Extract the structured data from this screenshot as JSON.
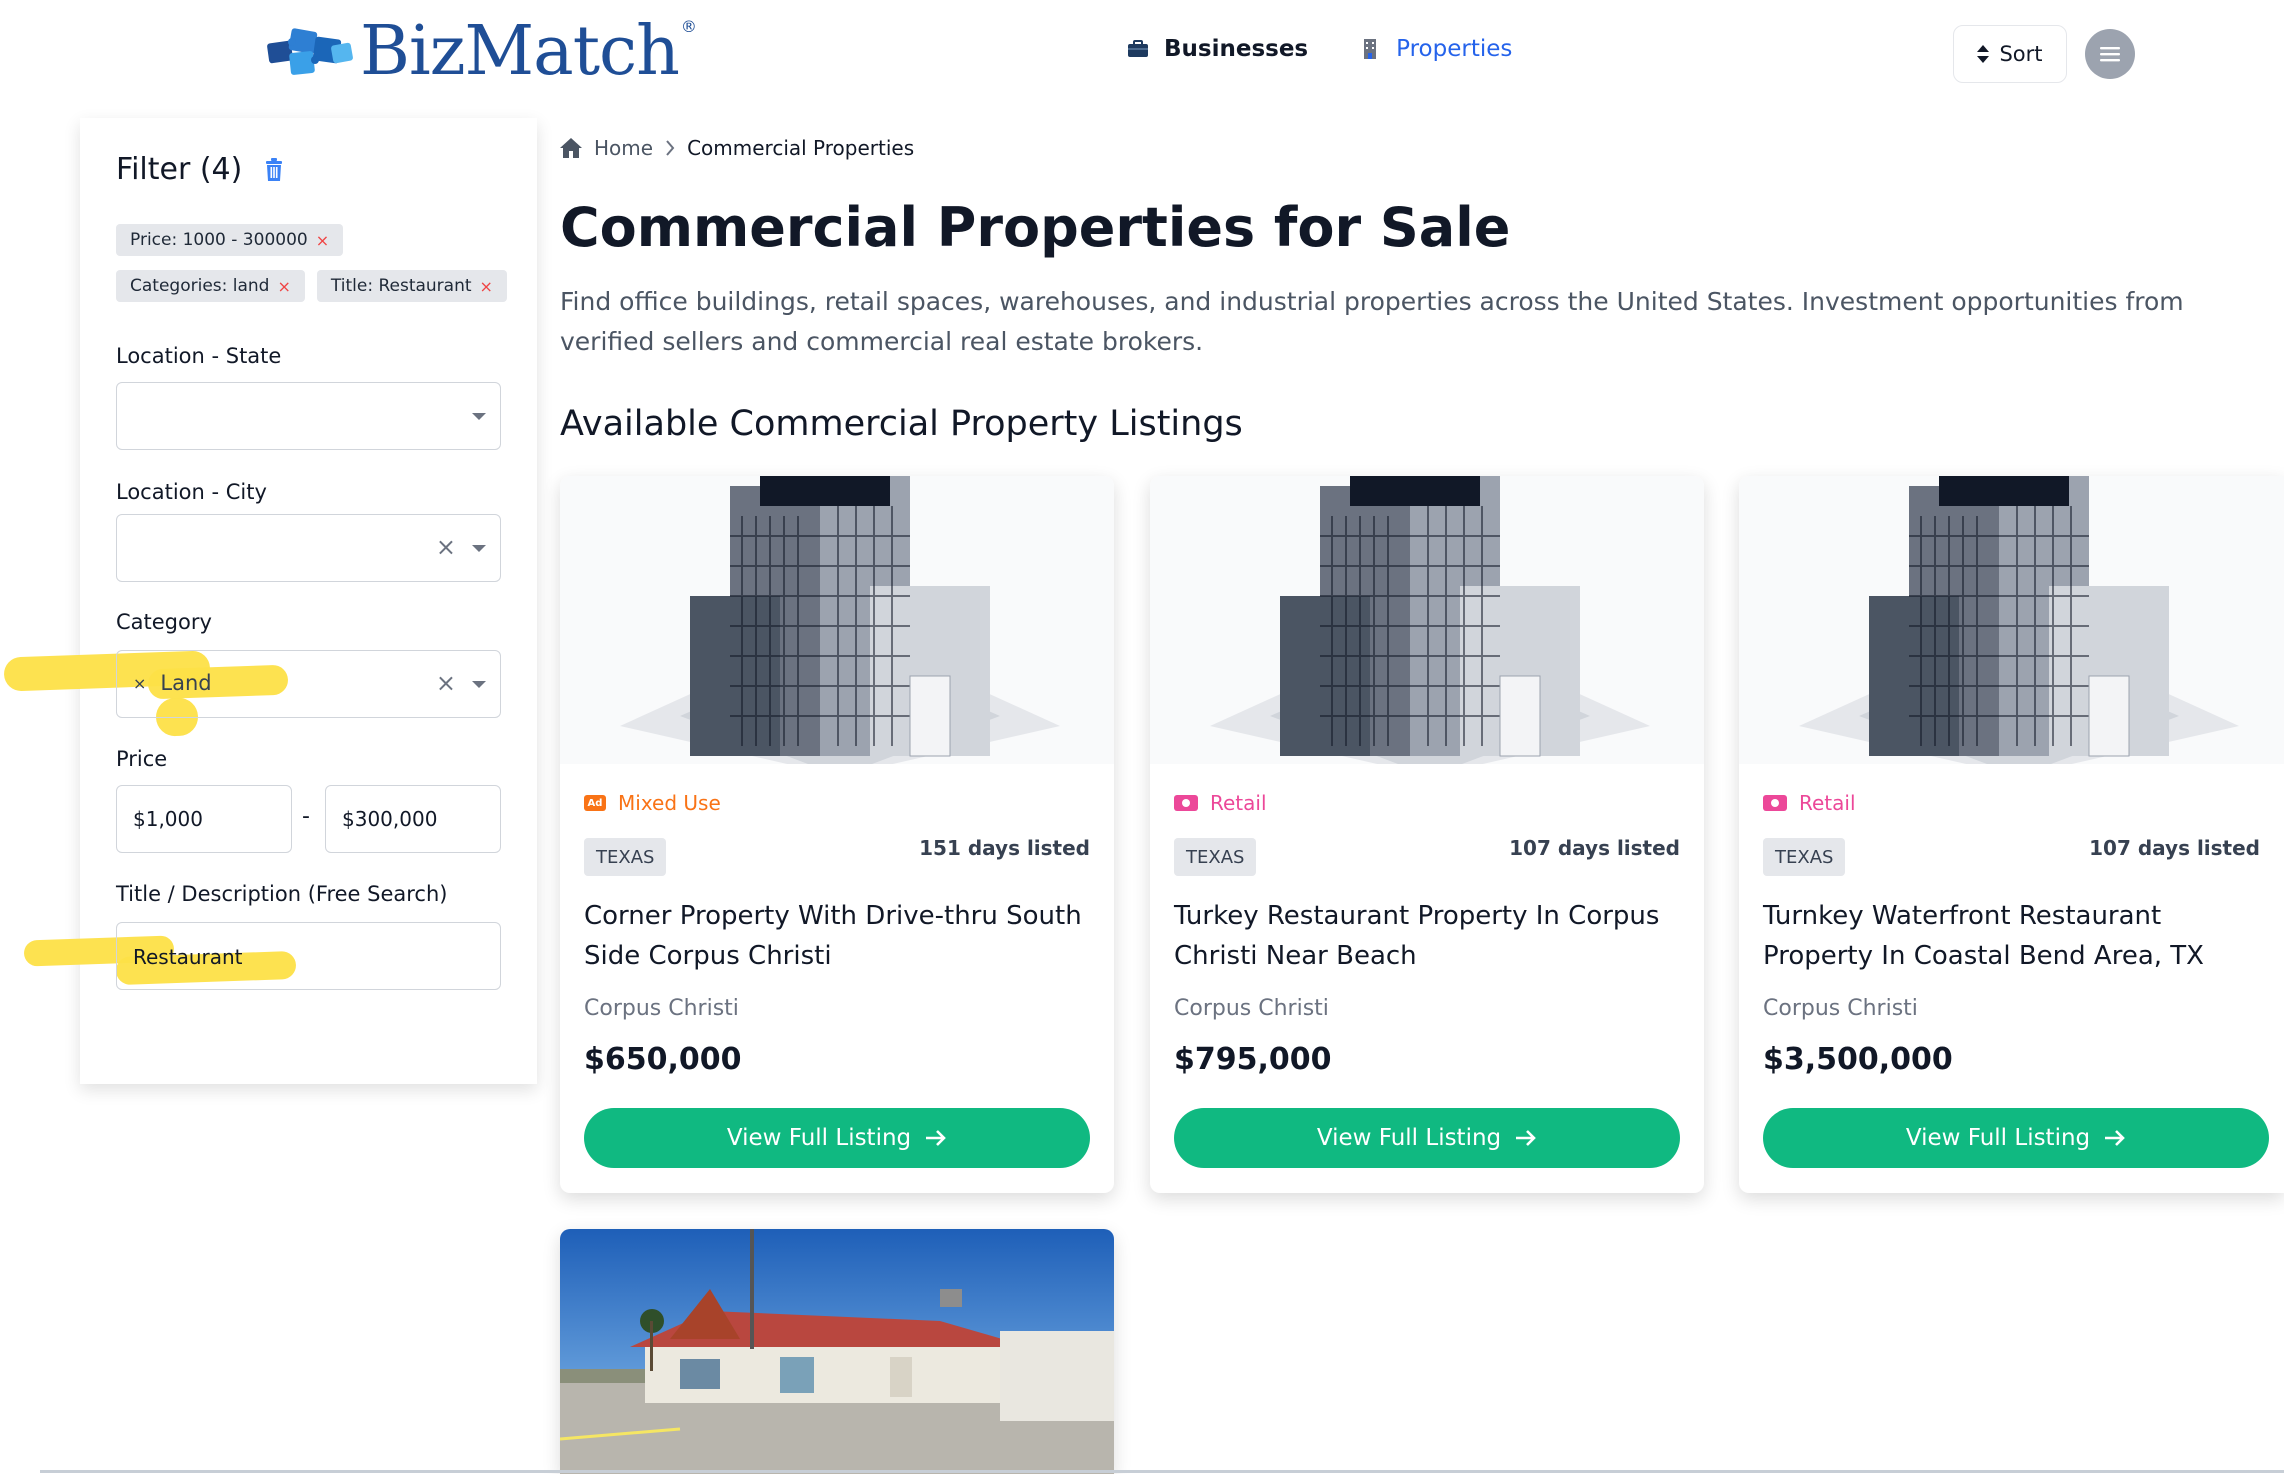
{
  "brand": {
    "name": "BizMatch",
    "reg": "®"
  },
  "nav": [
    {
      "label": "Businesses"
    },
    {
      "label": "Properties"
    }
  ],
  "sort": {
    "label": "Sort"
  },
  "filter": {
    "title": "Filter (4)",
    "chips": [
      "Price: 1000 - 300000",
      "Categories: land",
      "Title: Restaurant"
    ],
    "state_label": "Location - State",
    "city_label": "Location - City",
    "category_label": "Category",
    "category_value": "Land",
    "price_label": "Price",
    "price_min": "$1,000",
    "price_sep": "-",
    "price_max": "$300,000",
    "search_label": "Title / Description (Free Search)",
    "search_value": "Restaurant"
  },
  "breadcrumb": {
    "home": "Home",
    "current": "Commercial Properties"
  },
  "page": {
    "title": "Commercial Properties for Sale",
    "description": "Find office buildings, retail spaces, warehouses, and industrial properties across the United States. Investment opportunities from verified sellers and commercial real estate brokers.",
    "section": "Available Commercial Property Listings"
  },
  "listings": [
    {
      "category": "Mixed Use",
      "category_color": "#f97316",
      "icon_text": "Ad",
      "state": "TEXAS",
      "days": "151 days listed",
      "title": "Corner Property With Drive-thru South Side Corpus Christi",
      "city": "Corpus Christi",
      "price": "$650,000",
      "cta": "View Full Listing"
    },
    {
      "category": "Retail",
      "category_color": "#ec4899",
      "icon_text": "",
      "state": "TEXAS",
      "days": "107 days listed",
      "title": "Turkey Restaurant Property In Corpus Christi Near Beach",
      "city": "Corpus Christi",
      "price": "$795,000",
      "cta": "View Full Listing"
    },
    {
      "category": "Retail",
      "category_color": "#ec4899",
      "icon_text": "",
      "state": "TEXAS",
      "days": "107 days listed",
      "title": "Turnkey Waterfront Restaurant Property In Coastal Bend Area, TX",
      "city": "Corpus Christi",
      "price": "$3,500,000",
      "cta": "View Full Listing"
    }
  ],
  "colors": {
    "brand": "#1f4e96",
    "link": "#2563eb",
    "cta": "#10b981",
    "highlight": "#fde047"
  }
}
